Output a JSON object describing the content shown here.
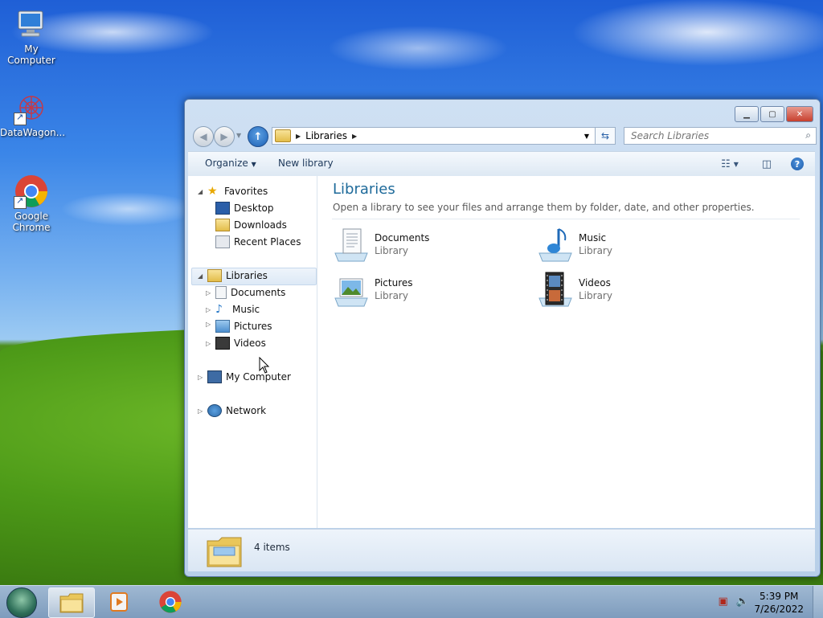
{
  "desktop": {
    "icons": [
      {
        "label": "My Computer"
      },
      {
        "label": "DataWagon..."
      },
      {
        "label": "Google Chrome"
      }
    ]
  },
  "window": {
    "address": {
      "crumb": "Libraries"
    },
    "search": {
      "placeholder": "Search Libraries"
    },
    "toolbar": {
      "organize": "Organize",
      "new_library": "New library"
    },
    "nav": {
      "favorites": {
        "label": "Favorites",
        "items": [
          "Desktop",
          "Downloads",
          "Recent Places"
        ]
      },
      "libraries": {
        "label": "Libraries",
        "items": [
          "Documents",
          "Music",
          "Pictures",
          "Videos"
        ]
      },
      "computer": "My Computer",
      "network": "Network"
    },
    "main": {
      "title": "Libraries",
      "description": "Open a library to see your files and arrange them by folder, date, and other properties.",
      "libraries": [
        {
          "name": "Documents",
          "type": "Library"
        },
        {
          "name": "Music",
          "type": "Library"
        },
        {
          "name": "Pictures",
          "type": "Library"
        },
        {
          "name": "Videos",
          "type": "Library"
        }
      ]
    },
    "details": {
      "count": "4 items"
    }
  },
  "taskbar": {
    "clock": {
      "time": "5:39 PM",
      "date": "7/26/2022"
    }
  },
  "colors": {
    "title": "#1e6a9a",
    "accent": "#1b5fb4"
  }
}
